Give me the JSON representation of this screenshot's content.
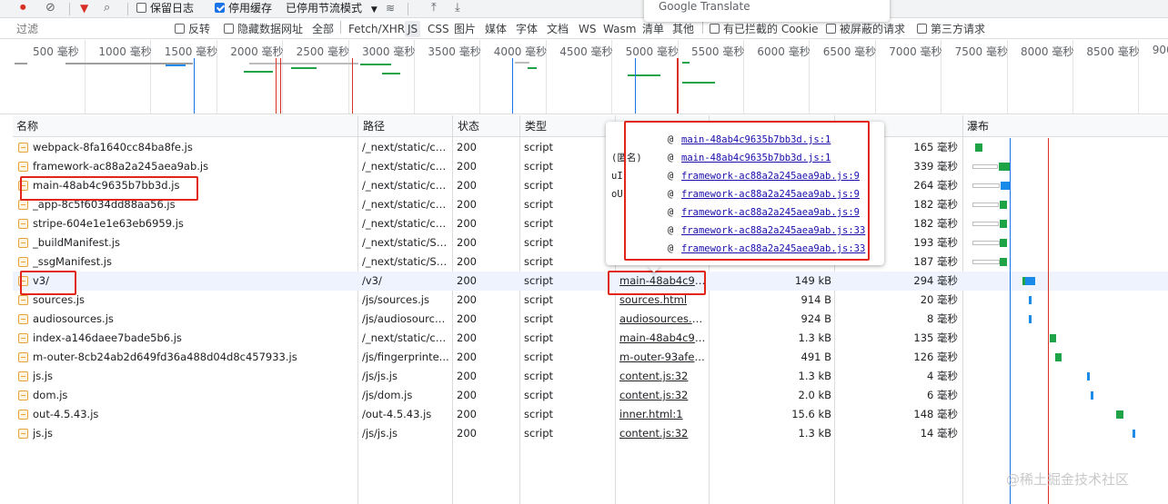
{
  "toolbar": {
    "preserve_log": "保留日志",
    "disable_cache": "停用缓存",
    "throttling": "已停用节流模式"
  },
  "filter": {
    "placeholder": "过滤",
    "invert": "反转",
    "hide_data_urls": "隐藏数据网址",
    "types": [
      "全部",
      "Fetch/XHR",
      "JS",
      "CSS",
      "图片",
      "媒体",
      "字体",
      "文档",
      "WS",
      "Wasm",
      "清单",
      "其他"
    ],
    "selected_type": "JS",
    "blocked_cookies": "有已拦截的 Cookie",
    "blocked_requests": "被屏蔽的请求",
    "third_party": "第三方请求"
  },
  "overview": {
    "ticks": [
      "500 毫秒",
      "1000 毫秒",
      "1500 毫秒",
      "2000 毫秒",
      "2500 毫秒",
      "3000 毫秒",
      "3500 毫秒",
      "4000 毫秒",
      "4500 毫秒",
      "5000 毫秒",
      "5500 毫秒",
      "6000 毫秒",
      "6500 毫秒",
      "7000 毫秒",
      "7500 毫秒",
      "8000 毫秒",
      "8500 毫秒",
      "9000"
    ]
  },
  "table": {
    "columns": [
      "名称",
      "路径",
      "状态",
      "类型",
      "",
      "",
      "",
      "瀑布"
    ],
    "rows": [
      {
        "name": "webpack-8fa1640cc84ba8fe.js",
        "path": "/_next/static/ch...",
        "status": "200",
        "type": "script",
        "initiator": "",
        "size": "",
        "time": "165 毫秒"
      },
      {
        "name": "framework-ac88a2a245aea9ab.js",
        "path": "/_next/static/ch...",
        "status": "200",
        "type": "script",
        "initiator": "",
        "size": "",
        "time": "339 毫秒"
      },
      {
        "name": "main-48ab4c9635b7bb3d.js",
        "path": "/_next/static/ch...",
        "status": "200",
        "type": "script",
        "initiator": "",
        "size": "",
        "time": "264 毫秒"
      },
      {
        "name": "_app-8c5f6034dd88aa56.js",
        "path": "/_next/static/ch...",
        "status": "200",
        "type": "script",
        "initiator": "",
        "size": "",
        "time": "182 毫秒"
      },
      {
        "name": "stripe-604e1e1e63eb6959.js",
        "path": "/_next/static/ch...",
        "status": "200",
        "type": "script",
        "initiator": "",
        "size": "",
        "time": "182 毫秒"
      },
      {
        "name": "_buildManifest.js",
        "path": "/_next/static/Ss...",
        "status": "200",
        "type": "script",
        "initiator": "",
        "size": "",
        "time": "193 毫秒"
      },
      {
        "name": "_ssgManifest.js",
        "path": "/_next/static/Ss...",
        "status": "200",
        "type": "script",
        "initiator": "",
        "size": "",
        "time": "187 毫秒"
      },
      {
        "name": "v3/",
        "path": "/v3/",
        "status": "200",
        "type": "script",
        "initiator": "main-48ab4c96...",
        "size": "149 kB",
        "time": "294 毫秒"
      },
      {
        "name": "sources.js",
        "path": "/js/sources.js",
        "status": "200",
        "type": "script",
        "initiator": "sources.html",
        "size": "914 B",
        "time": "20 毫秒"
      },
      {
        "name": "audiosources.js",
        "path": "/js/audiosource...",
        "status": "200",
        "type": "script",
        "initiator": "audiosources.ht...",
        "size": "924 B",
        "time": "8 毫秒"
      },
      {
        "name": "index-a146daee7bade5b6.js",
        "path": "/_next/static/ch...",
        "status": "200",
        "type": "script",
        "initiator": "main-48ab4c96...",
        "size": "1.3 kB",
        "time": "135 毫秒"
      },
      {
        "name": "m-outer-8cb24ab2d649fd36a488d04d8c457933.js",
        "path": "/js/fingerprinte...",
        "status": "200",
        "type": "script",
        "initiator": "m-outer-93afee...",
        "size": "491 B",
        "time": "126 毫秒"
      },
      {
        "name": "js.js",
        "path": "/js/js.js",
        "status": "200",
        "type": "script",
        "initiator": "content.js:32",
        "size": "1.3 kB",
        "time": "4 毫秒"
      },
      {
        "name": "dom.js",
        "path": "/js/dom.js",
        "status": "200",
        "type": "script",
        "initiator": "content.js:32",
        "size": "2.0 kB",
        "time": "6 毫秒"
      },
      {
        "name": "out-4.5.43.js",
        "path": "/out-4.5.43.js",
        "status": "200",
        "type": "script",
        "initiator": "inner.html:1",
        "size": "15.6 kB",
        "time": "148 毫秒"
      },
      {
        "name": "js.js",
        "path": "/js/js.js",
        "status": "200",
        "type": "script",
        "initiator": "content.js:32",
        "size": "1.3 kB",
        "time": "14 毫秒"
      }
    ]
  },
  "initiator_popup": {
    "stack": [
      {
        "fn": "",
        "link": "main-48ab4c9635b7bb3d.js:1"
      },
      {
        "fn": "(匿名)",
        "link": "main-48ab4c9635b7bb3d.js:1"
      },
      {
        "fn": "uI",
        "link": "framework-ac88a2a245aea9ab.js:9"
      },
      {
        "fn": "oU",
        "link": "framework-ac88a2a245aea9ab.js:9"
      },
      {
        "fn": "",
        "link": "framework-ac88a2a245aea9ab.js:9"
      },
      {
        "fn": "",
        "link": "framework-ac88a2a245aea9ab.js:33"
      },
      {
        "fn": "",
        "link": "framework-ac88a2a245aea9ab.js:33"
      }
    ]
  },
  "overlay": {
    "google_translate": "Google Translate",
    "watermark": "@稀土掘金技术社区"
  },
  "colors": {
    "accent": "#1a73e8",
    "highlight_box": "#e1251b",
    "waterfall_green": "#1ea446",
    "waterfall_blue": "#1a8be8",
    "dom_content_loaded": "#1a73e8",
    "load_event": "#d93025"
  }
}
